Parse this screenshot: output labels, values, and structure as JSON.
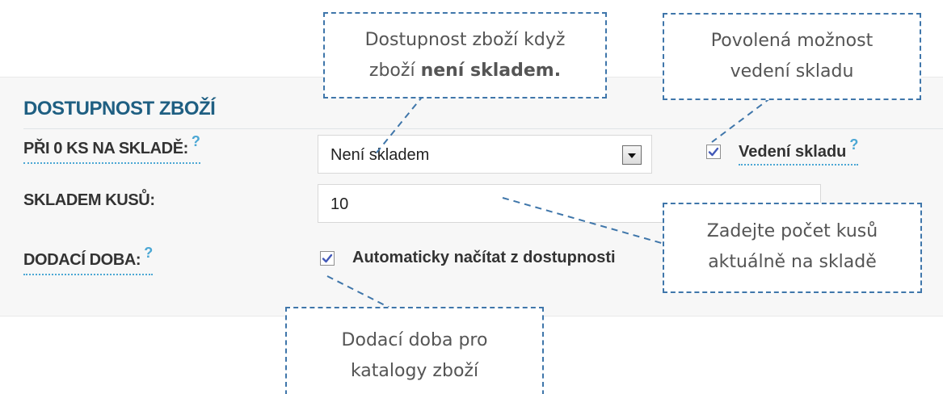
{
  "section": {
    "title": "DOSTUPNOST ZBOŽÍ"
  },
  "fields": {
    "stock_zero_label": "PŘI 0 KS NA SKLADĚ:",
    "stock_zero_help": "?",
    "stock_select_value": "Není skladem",
    "inventory_tracking_label": "Vedení skladu",
    "inventory_tracking_help": "?",
    "inventory_tracking_checked": true,
    "stock_count_label": "SKLADEM KUSŮ:",
    "stock_count_value": "10",
    "delivery_time_label": "DODACÍ DOBA:",
    "delivery_time_help": "?",
    "auto_load_label": "Automaticky načítat z dostupnosti",
    "auto_load_checked": true
  },
  "callouts": {
    "availability": {
      "line1": "Dostupnost zboží když",
      "line2_prefix": "zboží ",
      "line2_bold": "není skladem."
    },
    "inventory": {
      "line1": "Povolená možnost",
      "line2": "vedení skladu"
    },
    "stock_count": {
      "line1": "Zadejte počet kusů",
      "line2": "aktuálně na skladě"
    },
    "delivery": {
      "line1": "Dodací doba pro",
      "line2": "katalogy zboží"
    }
  },
  "colors": {
    "title": "#1f5f82",
    "help_icon": "#4ba7d4",
    "callout_border": "#3f76aa",
    "panel_background": "#f7f7f7"
  },
  "icons": {
    "checkbox_mark": "checkmark-icon",
    "select_arrow": "chevron-down-icon",
    "help": "question-mark-icon"
  }
}
